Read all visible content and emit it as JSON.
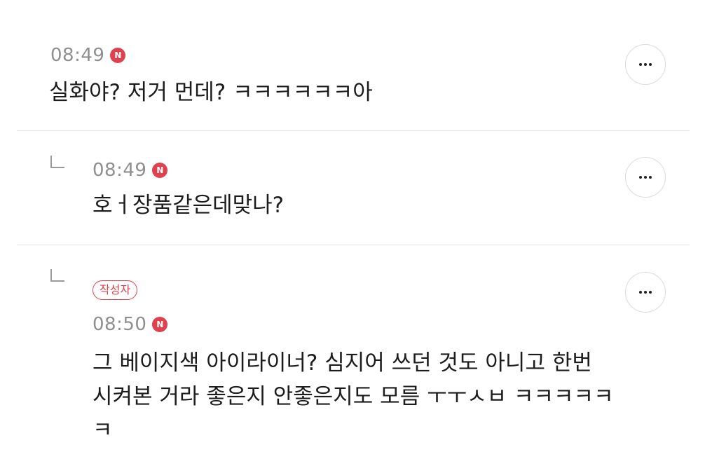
{
  "comments": [
    {
      "time": "08:49",
      "new_badge": "N",
      "text": "실화야? 저거 먼데? ㅋㅋㅋㅋㅋㅋ아",
      "more_icon": "ellipsis-icon"
    },
    {
      "time": "08:49",
      "new_badge": "N",
      "text": "호ㅓ장품같은데맞나?",
      "reply_icon": "reply-arrow-icon",
      "more_icon": "ellipsis-icon"
    },
    {
      "author_badge": "작성자",
      "time": "08:50",
      "new_badge": "N",
      "text_lines": [
        "그 베이지색 아이라이너? 심지어 쓰던 것도 아니고 한번",
        "시켜본 거라 좋은지 안좋은지도 모름 ㅜㅜㅅㅂ ㅋㅋㅋㅋㅋ",
        "ㅋ"
      ],
      "reply_icon": "reply-arrow-icon",
      "more_icon": "ellipsis-icon"
    }
  ],
  "colors": {
    "accent": "#e0414e",
    "time": "#8f8f8f",
    "divider": "#e4e4e4"
  }
}
